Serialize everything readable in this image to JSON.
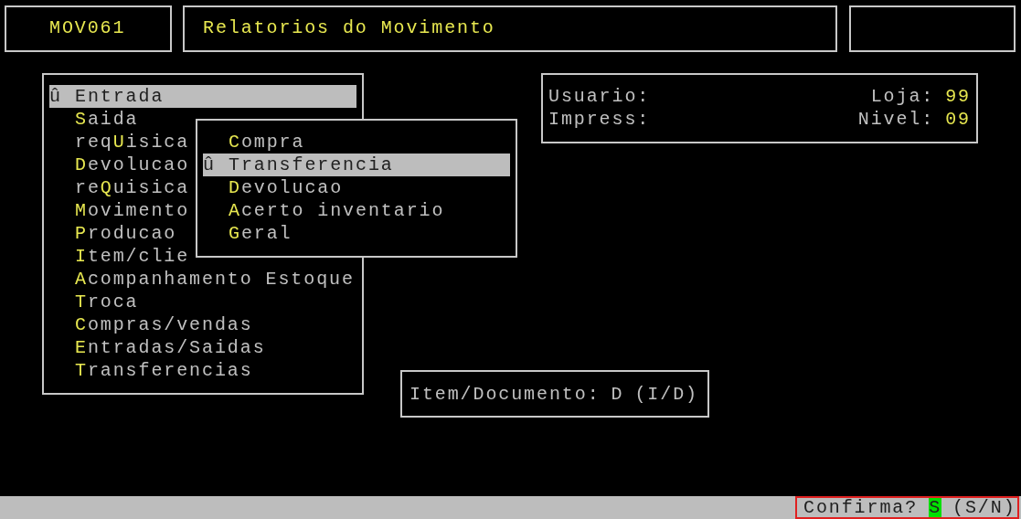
{
  "header": {
    "program_code": "MOV061",
    "title": "Relatorios do Movimento"
  },
  "menu": {
    "items": [
      {
        "label": "**E**ntrada",
        "marker": "û",
        "selected": true
      },
      {
        "label": "**S**aida",
        "selected": false
      },
      {
        "label": "req**U**isica",
        "selected": false
      },
      {
        "label": "**D**evolucao",
        "selected": false
      },
      {
        "label": "re**Q**uisica",
        "selected": false
      },
      {
        "label": "**M**ovimento",
        "selected": false
      },
      {
        "label": "**P**roducao",
        "selected": false
      },
      {
        "label": "**I**tem/clie",
        "selected": false
      },
      {
        "label": "**A**companhamento Estoque",
        "selected": false
      },
      {
        "label": "**T**roca",
        "selected": false
      },
      {
        "label": "**C**ompras/vendas",
        "selected": false
      },
      {
        "label": "**E**ntradas/Saidas",
        "selected": false
      },
      {
        "label": "**T**ransferencias",
        "selected": false
      }
    ]
  },
  "submenu": {
    "items": [
      {
        "label": "**C**ompra",
        "selected": false
      },
      {
        "label": "**T**ransferencia",
        "marker": "û",
        "selected": true
      },
      {
        "label": "**D**evolucao",
        "selected": false
      },
      {
        "label": "**A**certo inventario",
        "selected": false
      },
      {
        "label": "**G**eral",
        "selected": false
      }
    ]
  },
  "info": {
    "user_label": "Usuario:",
    "printer_label": "Impress:",
    "store_label": "Loja:",
    "store_value": "99",
    "level_label": "Nivel:",
    "level_value": "09"
  },
  "item_document": {
    "label": "Item/Documento:",
    "value": "D",
    "options": "(I/D)"
  },
  "status_bar": {
    "prompt": "Confirma?",
    "answer": "S",
    "options": "(S/N)"
  }
}
